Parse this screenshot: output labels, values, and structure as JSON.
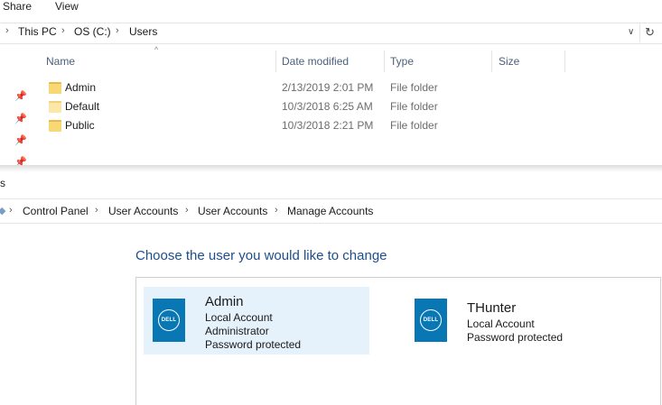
{
  "explorer": {
    "ribbon_tabs": [
      "Share",
      "View"
    ],
    "breadcrumb": [
      "This PC",
      "OS (C:)",
      "Users"
    ],
    "columns": {
      "name": "Name",
      "date": "Date modified",
      "type": "Type",
      "size": "Size"
    },
    "rows": [
      {
        "name": "Admin",
        "date": "2/13/2019 2:01 PM",
        "type": "File folder"
      },
      {
        "name": "Default",
        "date": "10/3/2018 6:25 AM",
        "type": "File folder"
      },
      {
        "name": "Public",
        "date": "10/3/2018 2:21 PM",
        "type": "File folder"
      }
    ],
    "refresh_glyph": "↻"
  },
  "control_panel": {
    "window_title_fragment": "s",
    "breadcrumb": [
      "Control Panel",
      "User Accounts",
      "User Accounts",
      "Manage Accounts"
    ],
    "title": "Choose the user you would like to change",
    "accounts": [
      {
        "name": "Admin",
        "lines": [
          "Local Account",
          "Administrator",
          "Password protected"
        ],
        "logo": "DELL"
      },
      {
        "name": "THunter",
        "lines": [
          "Local Account",
          "Password protected"
        ],
        "logo": "DELL"
      }
    ]
  },
  "colors": {
    "accent_title": "#1e4e8c",
    "selected_bg": "#e5f1fb",
    "avatar_bg": "#0a77b5"
  }
}
